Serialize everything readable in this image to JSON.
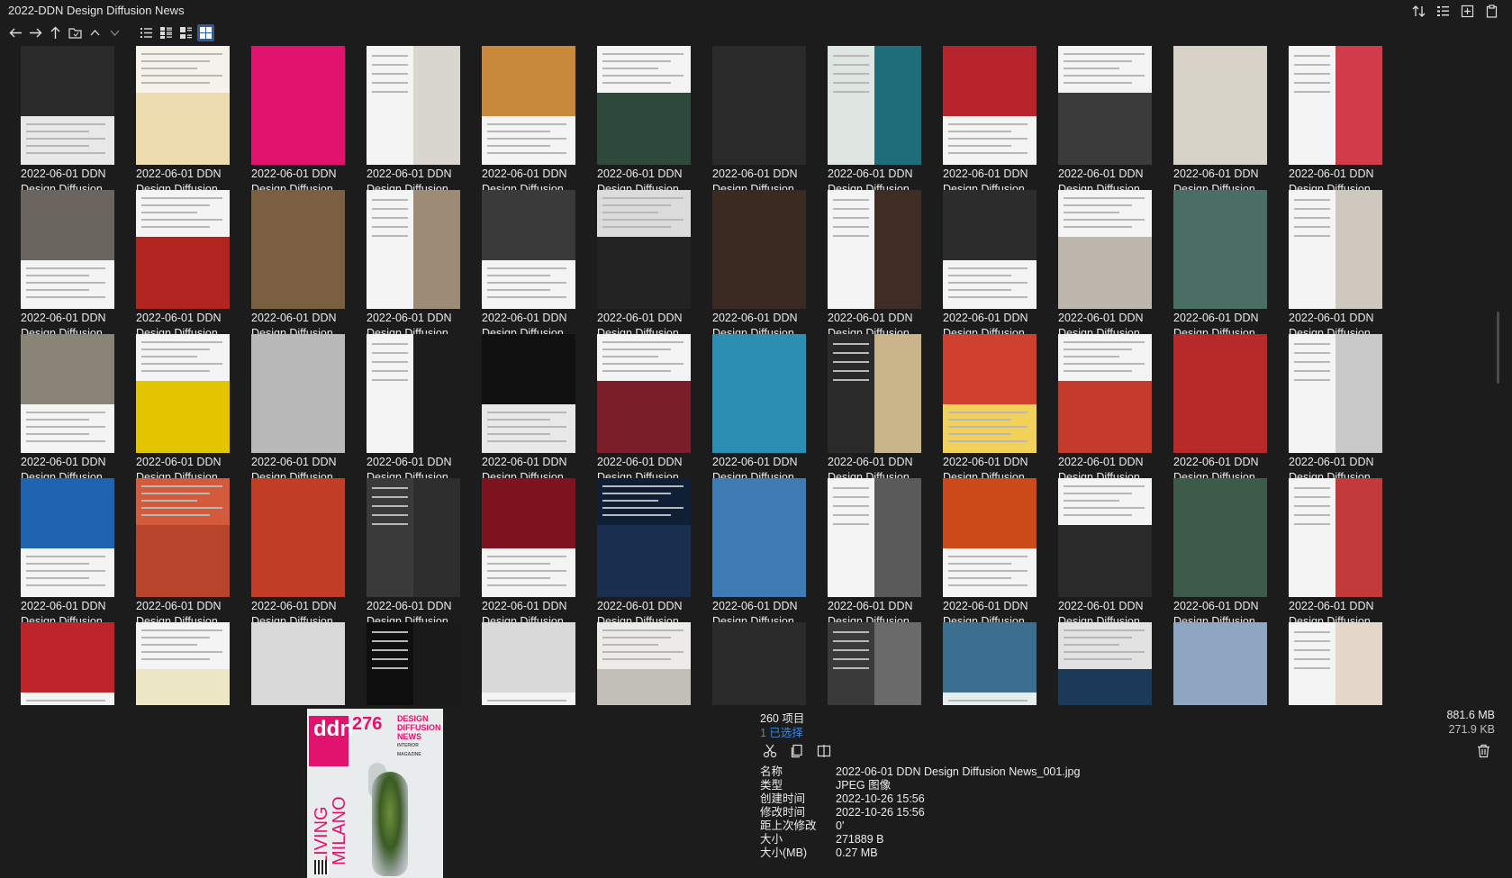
{
  "window": {
    "title": "2022-DDN Design Diffusion News"
  },
  "titlebar_icons": [
    {
      "name": "sort-icon"
    },
    {
      "name": "list-detail-icon"
    },
    {
      "name": "new-panel-icon"
    },
    {
      "name": "clipboard-icon"
    }
  ],
  "toolbar": {
    "nav": [
      {
        "name": "back-arrow-icon"
      },
      {
        "name": "forward-arrow-icon"
      },
      {
        "name": "up-arrow-icon"
      },
      {
        "name": "folder-icon"
      },
      {
        "name": "chevron-up-icon"
      },
      {
        "name": "chevron-down-icon"
      }
    ],
    "views": [
      {
        "name": "view-list-icon",
        "active": false
      },
      {
        "name": "view-details-icon",
        "active": false
      },
      {
        "name": "view-tiles-icon",
        "active": false
      },
      {
        "name": "view-thumbnails-icon",
        "active": true
      }
    ]
  },
  "grid": {
    "items": [
      {
        "line1": "2022-06-01 DDN",
        "line2": "Design Diffusion..."
      },
      {
        "line1": "2022-06-01 DDN",
        "line2": "Design Diffusion..."
      },
      {
        "line1": "2022-06-01 DDN",
        "line2": "Design Diffusion..."
      },
      {
        "line1": "2022-06-01 DDN",
        "line2": "Design Diffusion..."
      },
      {
        "line1": "2022-06-01 DDN",
        "line2": "Design Diffusion..."
      },
      {
        "line1": "2022-06-01 DDN",
        "line2": "Design Diffusion..."
      },
      {
        "line1": "2022-06-01 DDN",
        "line2": "Design Diffusion..."
      },
      {
        "line1": "2022-06-01 DDN",
        "line2": "Design Diffusion..."
      },
      {
        "line1": "2022-06-01 DDN",
        "line2": "Design Diffusion..."
      },
      {
        "line1": "2022-06-01 DDN",
        "line2": "Design Diffusion..."
      },
      {
        "line1": "2022-06-01 DDN",
        "line2": "Design Diffusion..."
      },
      {
        "line1": "2022-06-01 DDN",
        "line2": "Design Diffusion..."
      },
      {
        "line1": "2022-06-01 DDN",
        "line2": "Design Diffusion..."
      },
      {
        "line1": "2022-06-01 DDN",
        "line2": "Design Diffusion..."
      },
      {
        "line1": "2022-06-01 DDN",
        "line2": "Design Diffusion..."
      },
      {
        "line1": "2022-06-01 DDN",
        "line2": "Design Diffusion..."
      },
      {
        "line1": "2022-06-01 DDN",
        "line2": "Design Diffusion..."
      },
      {
        "line1": "2022-06-01 DDN",
        "line2": "Design Diffusion..."
      },
      {
        "line1": "2022-06-01 DDN",
        "line2": "Design Diffusion..."
      },
      {
        "line1": "2022-06-01 DDN",
        "line2": "Design Diffusion..."
      },
      {
        "line1": "2022-06-01 DDN",
        "line2": "Design Diffusion..."
      },
      {
        "line1": "2022-06-01 DDN",
        "line2": "Design Diffusion..."
      },
      {
        "line1": "2022-06-01 DDN",
        "line2": "Design Diffusion..."
      },
      {
        "line1": "2022-06-01 DDN",
        "line2": "Design Diffusion..."
      },
      {
        "line1": "2022-06-01 DDN",
        "line2": "Design Diffusion..."
      },
      {
        "line1": "2022-06-01 DDN",
        "line2": "Design Diffusion..."
      },
      {
        "line1": "2022-06-01 DDN",
        "line2": "Design Diffusion..."
      },
      {
        "line1": "2022-06-01 DDN",
        "line2": "Design Diffusion..."
      },
      {
        "line1": "2022-06-01 DDN",
        "line2": "Design Diffusion..."
      },
      {
        "line1": "2022-06-01 DDN",
        "line2": "Design Diffusion..."
      },
      {
        "line1": "2022-06-01 DDN",
        "line2": "Design Diffusion..."
      },
      {
        "line1": "2022-06-01 DDN",
        "line2": "Design Diffusion..."
      },
      {
        "line1": "2022-06-01 DDN",
        "line2": "Design Diffusion..."
      },
      {
        "line1": "2022-06-01 DDN",
        "line2": "Design Diffusion..."
      },
      {
        "line1": "2022-06-01 DDN",
        "line2": "Design Diffusion..."
      },
      {
        "line1": "2022-06-01 DDN",
        "line2": "Design Diffusion..."
      },
      {
        "line1": "2022-06-01 DDN",
        "line2": "Design Diffusion..."
      },
      {
        "line1": "2022-06-01 DDN",
        "line2": "Design Diffusion..."
      },
      {
        "line1": "2022-06-01 DDN",
        "line2": "Design Diffusion..."
      },
      {
        "line1": "2022-06-01 DDN",
        "line2": "Design Diffusion..."
      },
      {
        "line1": "2022-06-01 DDN",
        "line2": "Design Diffusion..."
      },
      {
        "line1": "2022-06-01 DDN",
        "line2": "Design Diffusion..."
      },
      {
        "line1": "2022-06-01 DDN",
        "line2": "Design Diffusion..."
      },
      {
        "line1": "2022-06-01 DDN",
        "line2": "Design Diffusion..."
      },
      {
        "line1": "2022-06-01 DDN",
        "line2": "Design Diffusion..."
      },
      {
        "line1": "2022-06-01 DDN",
        "line2": "Design Diffusion..."
      },
      {
        "line1": "2022-06-01 DDN",
        "line2": "Design Diffusion..."
      },
      {
        "line1": "2022-06-01 DDN",
        "line2": "Design Diffusion..."
      },
      {
        "line1": "",
        "line2": ""
      },
      {
        "line1": "",
        "line2": ""
      },
      {
        "line1": "",
        "line2": ""
      },
      {
        "line1": "",
        "line2": ""
      },
      {
        "line1": "",
        "line2": ""
      },
      {
        "line1": "",
        "line2": ""
      },
      {
        "line1": "",
        "line2": ""
      },
      {
        "line1": "",
        "line2": ""
      },
      {
        "line1": "",
        "line2": ""
      },
      {
        "line1": "",
        "line2": ""
      },
      {
        "line1": "",
        "line2": ""
      },
      {
        "line1": "",
        "line2": ""
      }
    ],
    "thumb_colors": [
      [
        "#2b2b2b",
        "#e8e8e8"
      ],
      [
        "#ecdcae",
        "#f5f2ea"
      ],
      [
        "#e2136e",
        "#f4f4f4"
      ],
      [
        "#d9d6cf",
        "#f4f4f4"
      ],
      [
        "#c88a3a",
        "#f4f4f4"
      ],
      [
        "#2f4a3c",
        "#f4f4f4"
      ],
      [
        "#2a2a2a",
        "#f4f4f4"
      ],
      [
        "#1f6d7a",
        "#dfe6e1"
      ],
      [
        "#b8242b",
        "#f4f4f4"
      ],
      [
        "#3b3b3b",
        "#f4f4f4"
      ],
      [
        "#d7d2c8",
        "#f4f4f4"
      ],
      [
        "#d23b4a",
        "#f4f4f4"
      ],
      [
        "#6b6560",
        "#f4f4f4"
      ],
      [
        "#b2241f",
        "#f4f4f4"
      ],
      [
        "#7a5f40",
        "#f4f4f4"
      ],
      [
        "#9d8b78",
        "#f4f4f4"
      ],
      [
        "#3a3a3a",
        "#f4f4f4"
      ],
      [
        "#232323",
        "#dcdcdc"
      ],
      [
        "#3b2a22",
        "#f4f4f4"
      ],
      [
        "#3f2c25",
        "#f4f4f4"
      ],
      [
        "#2c2c2c",
        "#f4f4f4"
      ],
      [
        "#bdb6ad",
        "#f4f4f4"
      ],
      [
        "#4a6e63",
        "#f4f4f4"
      ],
      [
        "#cfc8be",
        "#f4f4f4"
      ],
      [
        "#8a8478",
        "#f4f4f4"
      ],
      [
        "#e2c400",
        "#f4f4f4"
      ],
      [
        "#b9b9b9",
        "#f4f4f4"
      ],
      [
        "#1c1c1c",
        "#f4f4f4"
      ],
      [
        "#101010",
        "#e8e8e8"
      ],
      [
        "#7a1f2a",
        "#f4f4f4"
      ],
      [
        "#2b8fb3",
        "#f4f4f4"
      ],
      [
        "#c9b58a",
        "#2a2a2a"
      ],
      [
        "#d0402f",
        "#f1d15a"
      ],
      [
        "#c43a2c",
        "#f4f4f4"
      ],
      [
        "#b82a2a",
        "#f4f4f4"
      ],
      [
        "#c9c9c9",
        "#f4f4f4"
      ],
      [
        "#1e64b0",
        "#f4f4f4"
      ],
      [
        "#b8452b",
        "#d35a3a"
      ],
      [
        "#c23d25",
        "#e2532e"
      ],
      [
        "#2e2e2e",
        "#3a3a3a"
      ],
      [
        "#7d1420",
        "#f4f4f4"
      ],
      [
        "#1a2f4f",
        "#0f1f36"
      ],
      [
        "#3e7bb5",
        "#f0ece6"
      ],
      [
        "#5a5a5a",
        "#f4f4f4"
      ],
      [
        "#cc4a1a",
        "#f4f4f4"
      ],
      [
        "#2a2a2a",
        "#f4f4f4"
      ],
      [
        "#3e5a4a",
        "#4d6a58"
      ],
      [
        "#c23a3a",
        "#f4f4f4"
      ],
      [
        "#c0242b",
        "#f4f4f4"
      ],
      [
        "#ece6c4",
        "#f4f4f4"
      ],
      [
        "#d9d9d9",
        "#f4f4f4"
      ],
      [
        "#1a1a1a",
        "#0f0f0f"
      ],
      [
        "#d9d9d9",
        "#f4f4f4"
      ],
      [
        "#c2beb8",
        "#ecebe7"
      ],
      [
        "#2b2b2b",
        "#e8e8e8"
      ],
      [
        "#6a6a6a",
        "#3a3a3a"
      ],
      [
        "#3a6f8f",
        "#e8eef0"
      ],
      [
        "#1b3a5a",
        "#e2e2e2"
      ],
      [
        "#8fa6c2",
        "#d8e0e8"
      ],
      [
        "#e3d7c9",
        "#f4f4f4"
      ]
    ]
  },
  "panel": {
    "count": "260 项目",
    "selected": "1 已选择",
    "size_total": "881.6 MB",
    "size_selected": "271.9 KB",
    "actions": [
      {
        "name": "cut-icon"
      },
      {
        "name": "copy-icon"
      },
      {
        "name": "compare-icon"
      }
    ],
    "properties": [
      {
        "key": "名称",
        "value": "2022-06-01 DDN Design Diffusion News_001.jpg"
      },
      {
        "key": "类型",
        "value": "JPEG 图像"
      },
      {
        "key": "创建时间",
        "value": "2022-10-26  15:56"
      },
      {
        "key": "修改时间",
        "value": "2022-10-26  15:56"
      },
      {
        "key": "距上次修改",
        "value": "0'"
      },
      {
        "key": "大小",
        "value": "271889 B"
      },
      {
        "key": "大小(MB)",
        "value": "0.27 MB"
      }
    ],
    "cover": {
      "logo": "ddn",
      "number": "276",
      "brand": "DESIGN DIFFUSION NEWS",
      "brand_sub": "INTERIOR MAGAZINE",
      "vertical": "LIVING MILANO"
    }
  }
}
